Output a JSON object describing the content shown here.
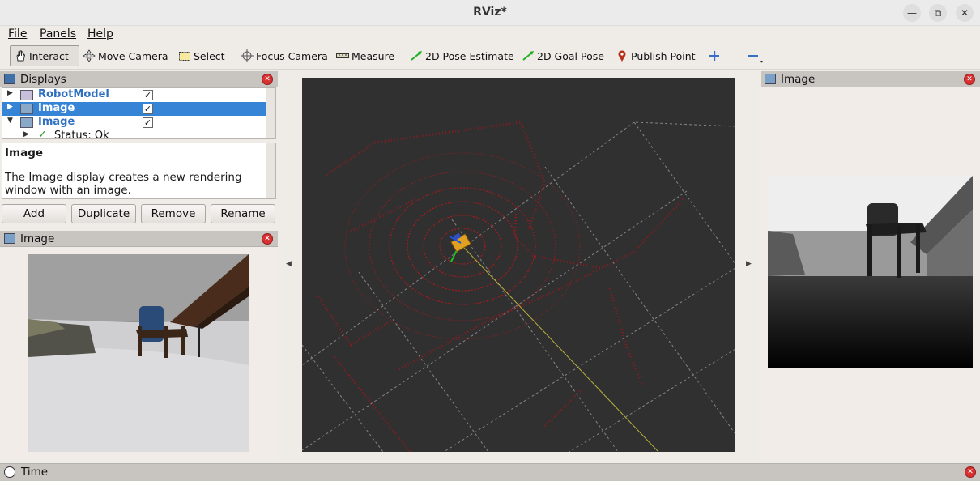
{
  "window": {
    "title": "RViz*"
  },
  "menu": {
    "file": "File",
    "panels": "Panels",
    "help": "Help"
  },
  "toolbar": {
    "interact": "Interact",
    "move_camera": "Move Camera",
    "select": "Select",
    "focus_camera": "Focus Camera",
    "measure": "Measure",
    "pose_estimate": "2D Pose Estimate",
    "goal_pose": "2D Goal Pose",
    "publish_point": "Publish Point"
  },
  "displays_panel": {
    "title": "Displays",
    "items": [
      {
        "label": "RobotModel",
        "checked": "✓"
      },
      {
        "label": "Image",
        "checked": "✓"
      },
      {
        "label": "Image",
        "checked": "✓"
      },
      {
        "label": "Status: Ok"
      }
    ],
    "description_title": "Image",
    "description_text": "The Image display creates a new rendering window with an image.",
    "buttons": {
      "add": "Add",
      "duplicate": "Duplicate",
      "remove": "Remove",
      "rename": "Rename"
    }
  },
  "left_image_panel": {
    "title": "Image"
  },
  "right_image_panel": {
    "title": "Image"
  },
  "time_panel": {
    "title": "Time"
  },
  "colors": {
    "accent": "#3584d6",
    "viewport_bg": "#303030",
    "laser": "#c0161a"
  }
}
